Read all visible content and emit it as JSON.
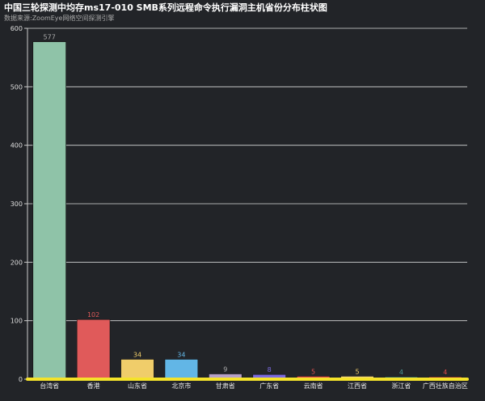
{
  "chart_data": {
    "type": "bar",
    "title": "中国三轮探测中均存ms17-010 SMB系列远程命令执行漏洞主机省份分布柱状图",
    "subtitle": "数据来源:ZoomEye网络空间探测引擎",
    "categories": [
      "台湾省",
      "香港",
      "山东省",
      "北京市",
      "甘肃省",
      "广东省",
      "云南省",
      "江西省",
      "浙江省",
      "广西壮族自治区"
    ],
    "values": [
      577,
      102,
      34,
      34,
      9,
      8,
      5,
      5,
      4,
      4
    ],
    "colors": [
      "#8fc3a8",
      "#e05a5a",
      "#f0cd6a",
      "#62b6e6",
      "#b5a0c8",
      "#7b6ae0",
      "#e05050",
      "#f2d77a",
      "#4a9a96",
      "#e04848"
    ],
    "label_colors": [
      "#aaaaaa",
      "#e05a5a",
      "#f0cd6a",
      "#62b6e6",
      "#aaaaaa",
      "#7b6ae0",
      "#e05050",
      "#f0cd6a",
      "#4a9a96",
      "#e04848"
    ],
    "yticks": [
      0,
      100,
      200,
      300,
      400,
      500,
      600
    ],
    "ylim": [
      0,
      600
    ],
    "grid": true,
    "baseline_color": "#f5e32a",
    "xlabel": "",
    "ylabel": ""
  }
}
